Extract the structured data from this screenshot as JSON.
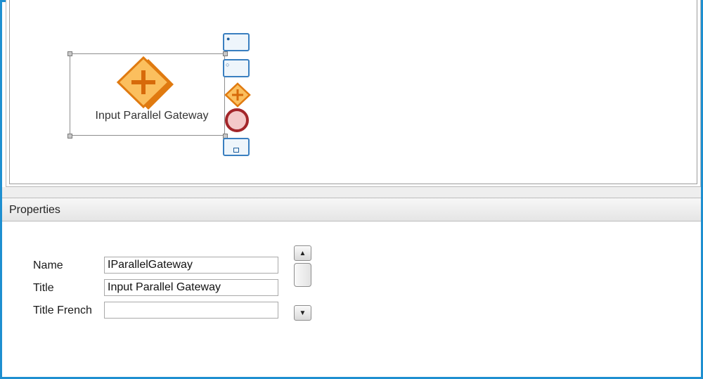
{
  "diagram": {
    "node_label": "Input Parallel Gateway",
    "palette": [
      {
        "name": "user-task-icon"
      },
      {
        "name": "service-task-icon"
      },
      {
        "name": "parallel-gateway-icon"
      },
      {
        "name": "end-event-icon"
      },
      {
        "name": "subprocess-icon"
      }
    ],
    "colors": {
      "gateway_fill": "#f7b24a",
      "gateway_border": "#e07a10",
      "end_event_fill": "#f4c9c9",
      "end_event_border": "#a3262a",
      "task_border": "#3a7fc0"
    }
  },
  "properties": {
    "title": "Properties",
    "fields": [
      {
        "label": "Name",
        "value": "IParallelGateway"
      },
      {
        "label": "Title",
        "value": "Input Parallel Gateway"
      },
      {
        "label": "Title French",
        "value": ""
      }
    ]
  }
}
